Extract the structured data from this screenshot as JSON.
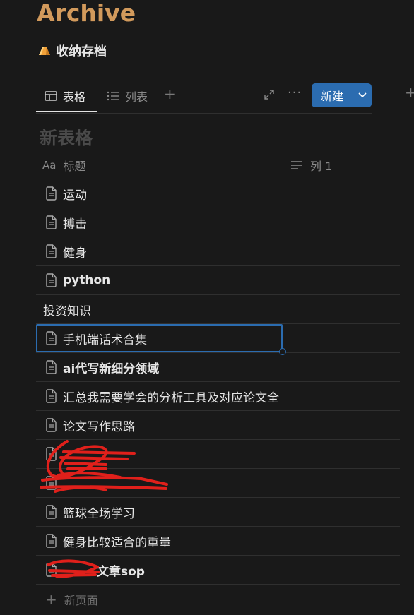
{
  "page": {
    "title": "Archive"
  },
  "database": {
    "icon": "archive-box-icon",
    "title": "收纳存档"
  },
  "tabs": [
    {
      "label": "表格",
      "icon": "table-icon",
      "active": true
    },
    {
      "label": "列表",
      "icon": "list-icon",
      "active": false
    }
  ],
  "toolbar": {
    "new_label": "新建",
    "more_label": "···"
  },
  "table": {
    "title": "新表格",
    "columns": [
      {
        "label": "标题",
        "type_label": "Aa"
      },
      {
        "label": "列 1"
      }
    ],
    "rows": [
      {
        "name": "运动",
        "icon": true
      },
      {
        "name": "搏击",
        "icon": true
      },
      {
        "name": "健身",
        "icon": true
      },
      {
        "name": "python",
        "icon": true,
        "bold": true
      },
      {
        "name": "投资知识",
        "icon": false
      },
      {
        "name": "手机端话术合集",
        "icon": true,
        "selected": true
      },
      {
        "name": "ai代写新细分领域",
        "icon": true,
        "bold": true
      },
      {
        "name": "汇总我需要学会的分析工具及对应论文全",
        "icon": true
      },
      {
        "name": "论文写作思路",
        "icon": true
      },
      {
        "name": "",
        "icon": true,
        "redacted": true
      },
      {
        "name": "",
        "icon": true,
        "redacted": true
      },
      {
        "name": "篮球全场学习",
        "icon": true
      },
      {
        "name": "健身比较适合的重量",
        "icon": true
      },
      {
        "name": "文章sop",
        "icon": true,
        "bold_partial": true,
        "redacted": true
      }
    ],
    "new_page_label": "新页面"
  },
  "colors": {
    "accent": "#2b6cb0",
    "title": "#d29a5c",
    "background": "#191919"
  }
}
